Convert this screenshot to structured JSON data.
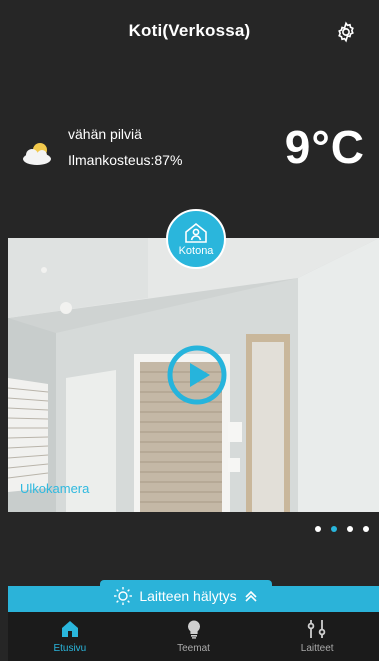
{
  "header": {
    "title": "Koti(Verkossa)"
  },
  "weather": {
    "icon": "partly-cloudy-icon",
    "description": "vähän pilviä",
    "humidity": "Ilmankosteus:87%",
    "temperature": "9°C"
  },
  "mode": {
    "label": "Kotona",
    "icon": "home-person-icon"
  },
  "camera": {
    "label": "Ulkokamera"
  },
  "carousel": {
    "count": 4,
    "active_index": 1
  },
  "alarm": {
    "label": "Laitteen hälytys"
  },
  "nav": {
    "items": [
      {
        "label": "Etusivu",
        "icon": "home-icon",
        "active": true
      },
      {
        "label": "Teemat",
        "icon": "lightbulb-icon",
        "active": false
      },
      {
        "label": "Laitteet",
        "icon": "sliders-icon",
        "active": false
      }
    ]
  },
  "colors": {
    "accent": "#2ab6dc",
    "background": "#262626",
    "nav": "#1b1b1b"
  }
}
